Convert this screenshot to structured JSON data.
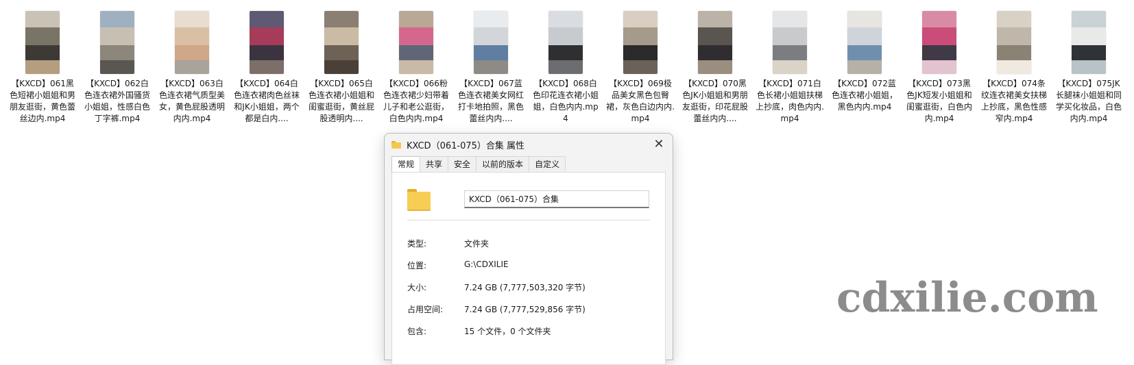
{
  "files": [
    {
      "name": "【KXCD】061黑色短裙小姐姐和男朋友逛街，黄色蕾丝边内.mp4",
      "colors": [
        "#c9c2b6",
        "#7a7466",
        "#3d3a36",
        "#b59e80"
      ]
    },
    {
      "name": "【KXCD】062白色连衣裙外国骚货小姐姐，性感白色丁字裤.mp4",
      "colors": [
        "#9fb0c0",
        "#c7c0b2",
        "#8d867b",
        "#5a5652"
      ]
    },
    {
      "name": "【KXCD】063白色连衣裙气质型美女，黄色屁股透明内内.mp4",
      "colors": [
        "#e8ddd0",
        "#d9bfa4",
        "#cfa789",
        "#a8a39b"
      ]
    },
    {
      "name": "【KXCD】064白色连衣裙肉色丝袜和JK小姐姐，两个都是白内....",
      "colors": [
        "#5e5a73",
        "#a73c5a",
        "#3b3340",
        "#7c6f6a"
      ]
    },
    {
      "name": "【KXCD】065白色连衣裙小姐姐和闺蜜逛街，黄丝屁股透明内....",
      "colors": [
        "#8a7f72",
        "#cbbba5",
        "#6e6257",
        "#4a4038"
      ]
    },
    {
      "name": "【KXCD】066粉色连衣裙少妇带着儿子和老公逛街，白色内内.mp4",
      "colors": [
        "#b9a896",
        "#d6678c",
        "#5f6677",
        "#c9b9a7"
      ]
    },
    {
      "name": "【KXCD】067蓝色连衣裙美女网红打卡地拍照，黑色蕾丝内内....",
      "colors": [
        "#e8ecef",
        "#d2d6d8",
        "#5f7ea1",
        "#8e8a85"
      ]
    },
    {
      "name": "【KXCD】068白色印花连衣裙小姐姐，白色内内.mp4",
      "colors": [
        "#d9dde2",
        "#c7cbd0",
        "#2f2f31",
        "#6b6d70"
      ]
    },
    {
      "name": "【KXCD】069极品美女黑色包臀裙，灰色白边内内.mp4",
      "colors": [
        "#d8cfc2",
        "#a69a8b",
        "#2b2a2c",
        "#6a6259"
      ]
    },
    {
      "name": "【KXCD】070黑色JK小姐姐和男朋友逛街，印花屁股蕾丝内内....",
      "colors": [
        "#bcb3a8",
        "#5a5550",
        "#2f2d30",
        "#9a8e80"
      ]
    },
    {
      "name": "【KXCD】071白色长裙小姐姐扶梯上抄底，肉色内内.mp4",
      "colors": [
        "#e4e6e8",
        "#c8cacc",
        "#7b7d80",
        "#d9d3c8"
      ]
    },
    {
      "name": "【KXCD】072蓝色连衣裙小姐姐，黑色内内.mp4",
      "colors": [
        "#e7e5e1",
        "#cfd4d9",
        "#6f8fae",
        "#b7b0a6"
      ]
    },
    {
      "name": "【KXCD】073黑色JK短发小姐姐和闺蜜逛街，白色内内.mp4",
      "colors": [
        "#d98ba6",
        "#c94d78",
        "#3f3a45",
        "#e3c3cf"
      ]
    },
    {
      "name": "【KXCD】074条纹连衣裙美女扶梯上抄底，黑色性感窄内.mp4",
      "colors": [
        "#d8d2c6",
        "#bfb8aa",
        "#8a8273",
        "#efe9df"
      ]
    },
    {
      "name": "【KXCD】075JK长腿袜小姐姐和同学买化妆品，白色内内.mp4",
      "colors": [
        "#c9d2d4",
        "#e8eaea",
        "#2f3236",
        "#b7c3c6"
      ]
    }
  ],
  "dialog": {
    "title": "KXCD（061-075）合集 属性",
    "close_label": "✕",
    "tabs": [
      "常规",
      "共享",
      "安全",
      "以前的版本",
      "自定义"
    ],
    "folder_name": "KXCD（061-075）合集",
    "props": [
      {
        "key": "类型:",
        "value": "文件夹"
      },
      {
        "key": "位置:",
        "value": "G:\\CDXILIE"
      },
      {
        "key": "大小:",
        "value": "7.24 GB (7,777,503,320 字节)"
      },
      {
        "key": "占用空间:",
        "value": "7.24 GB (7,777,529,856 字节)"
      },
      {
        "key": "包含:",
        "value": "15 个文件，0 个文件夹"
      }
    ]
  },
  "watermark": "cdxilie.com",
  "icons": {
    "folder": "folder-icon",
    "close": "close-icon"
  }
}
